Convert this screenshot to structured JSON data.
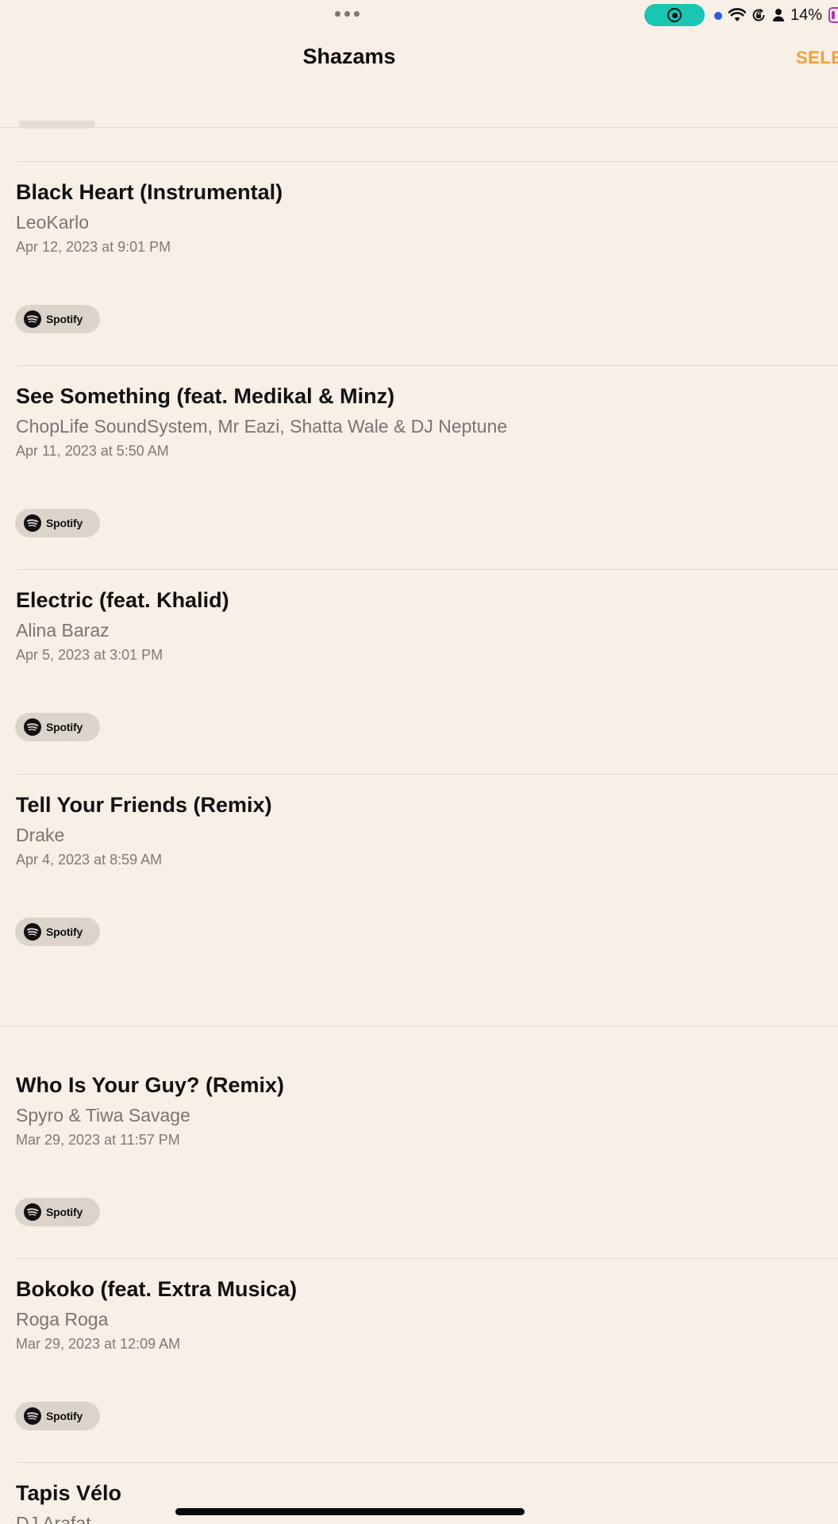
{
  "status_bar": {
    "battery_percent": "14%",
    "screen_recording": true,
    "icons": [
      "more-dots-icon",
      "screen-record-icon",
      "wifi-icon",
      "rotation-lock-icon",
      "person-icon",
      "battery-icon"
    ],
    "colors": {
      "record_pill": "#19c6b3",
      "location_dot": "#1f5fe0",
      "battery": "#b13aa8"
    }
  },
  "nav": {
    "title": "Shazams",
    "select_label": "SELE",
    "accent_color": "#f2a03a"
  },
  "tracks": [
    {
      "title": "Black Heart (Instrumental)",
      "artist": "LeoKarlo",
      "date": "Apr 12, 2023 at 9:01 PM",
      "service": "Spotify"
    },
    {
      "title": "See Something (feat. Medikal & Minz)",
      "artist": "ChopLife SoundSystem, Mr Eazi, Shatta Wale & DJ Neptune",
      "date": "Apr 11, 2023 at 5:50 AM",
      "service": "Spotify"
    },
    {
      "title": "Electric (feat. Khalid)",
      "artist": "Alina Baraz",
      "date": "Apr 5, 2023 at 3:01 PM",
      "service": "Spotify"
    },
    {
      "title": "Tell Your Friends (Remix)",
      "artist": "Drake",
      "date": "Apr 4, 2023 at 8:59 AM",
      "service": "Spotify"
    },
    {
      "title": "Who Is Your Guy? (Remix)",
      "artist": "Spyro & Tiwa Savage",
      "date": "Mar 29, 2023 at 11:57 PM",
      "service": "Spotify"
    },
    {
      "title": "Bokoko (feat. Extra Musica)",
      "artist": "Roga Roga",
      "date": "Mar 29, 2023 at 12:09 AM",
      "service": "Spotify"
    },
    {
      "title": "Tapis Vélo",
      "artist": "DJ Arafat",
      "date": "",
      "service": ""
    }
  ]
}
